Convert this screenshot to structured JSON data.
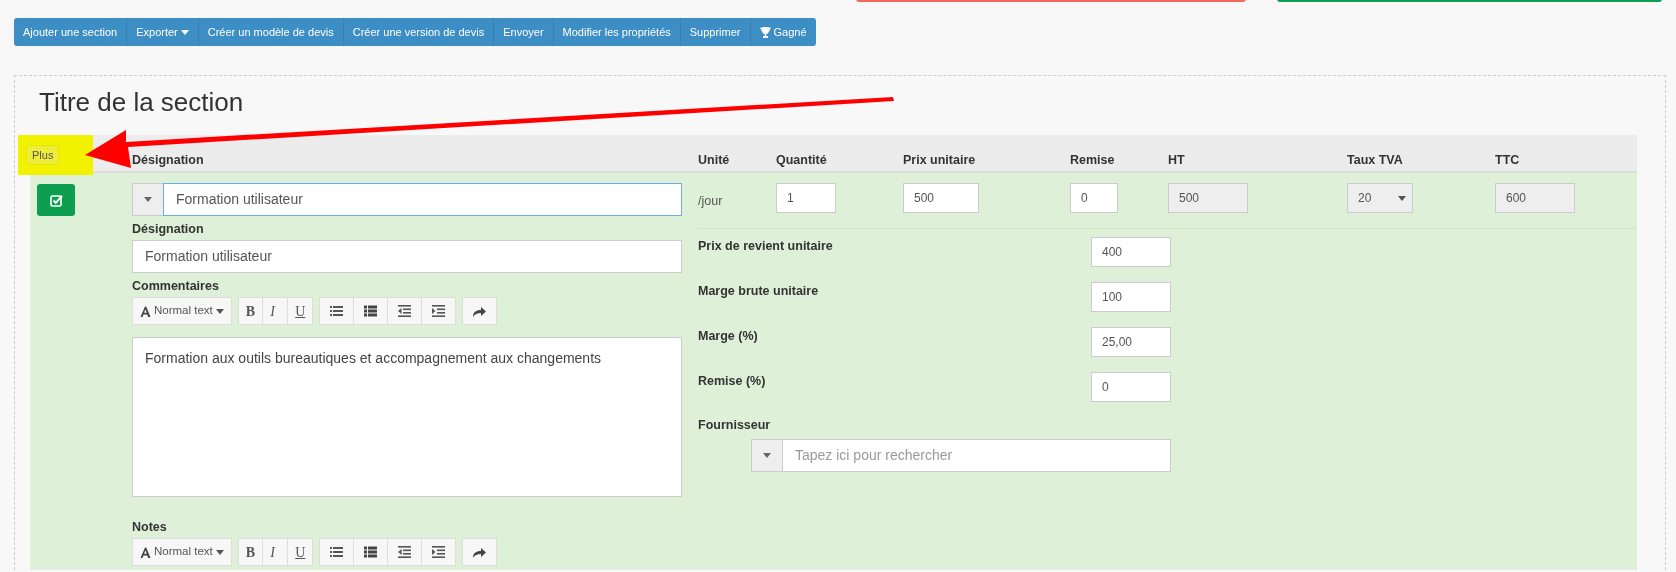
{
  "toolbar": [
    {
      "label": "Ajouter une section",
      "kind": "button"
    },
    {
      "label": "Exporter",
      "kind": "dropdown"
    },
    {
      "label": "Créer un modèle de devis",
      "kind": "button"
    },
    {
      "label": "Créer une version de devis",
      "kind": "button"
    },
    {
      "label": "Envoyer",
      "kind": "button"
    },
    {
      "label": "Modifier les propriétés",
      "kind": "button"
    },
    {
      "label": "Supprimer",
      "kind": "button"
    },
    {
      "label": "Gagné",
      "kind": "trophy"
    }
  ],
  "section": {
    "title": "Titre de la section",
    "more_button": "Plus",
    "columns": [
      "Désignation",
      "Unité",
      "Quantité",
      "Prix unitaire",
      "Remise",
      "HT",
      "Taux TVA",
      "TTC"
    ],
    "line": {
      "checked": true,
      "designation_search": "Formation utilisateur",
      "designation_label": "Désignation",
      "designation": "Formation utilisateur",
      "comments_label": "Commentaires",
      "comments_editor": {
        "style": "Normal text",
        "format_buttons": [
          "B",
          "I",
          "U"
        ]
      },
      "comments": "Formation aux outils bureautiques et accompagnement aux changements",
      "notes_label": "Notes",
      "notes_editor": {
        "style": "Normal text",
        "format_buttons": [
          "B",
          "I",
          "U"
        ]
      },
      "unit": "/jour",
      "quantity": "1",
      "unit_price": "500",
      "discount": "0",
      "ht": "500",
      "vat_rate": "20",
      "ttc": "600",
      "details": [
        {
          "label": "Prix de revient unitaire",
          "value": "400"
        },
        {
          "label": "Marge brute unitaire",
          "value": "100"
        },
        {
          "label": "Marge (%)",
          "value": "25,00"
        },
        {
          "label": "Remise (%)",
          "value": "0"
        }
      ],
      "supplier_label": "Fournisseur",
      "supplier_placeholder": "Tapez ici pour rechercher"
    }
  }
}
